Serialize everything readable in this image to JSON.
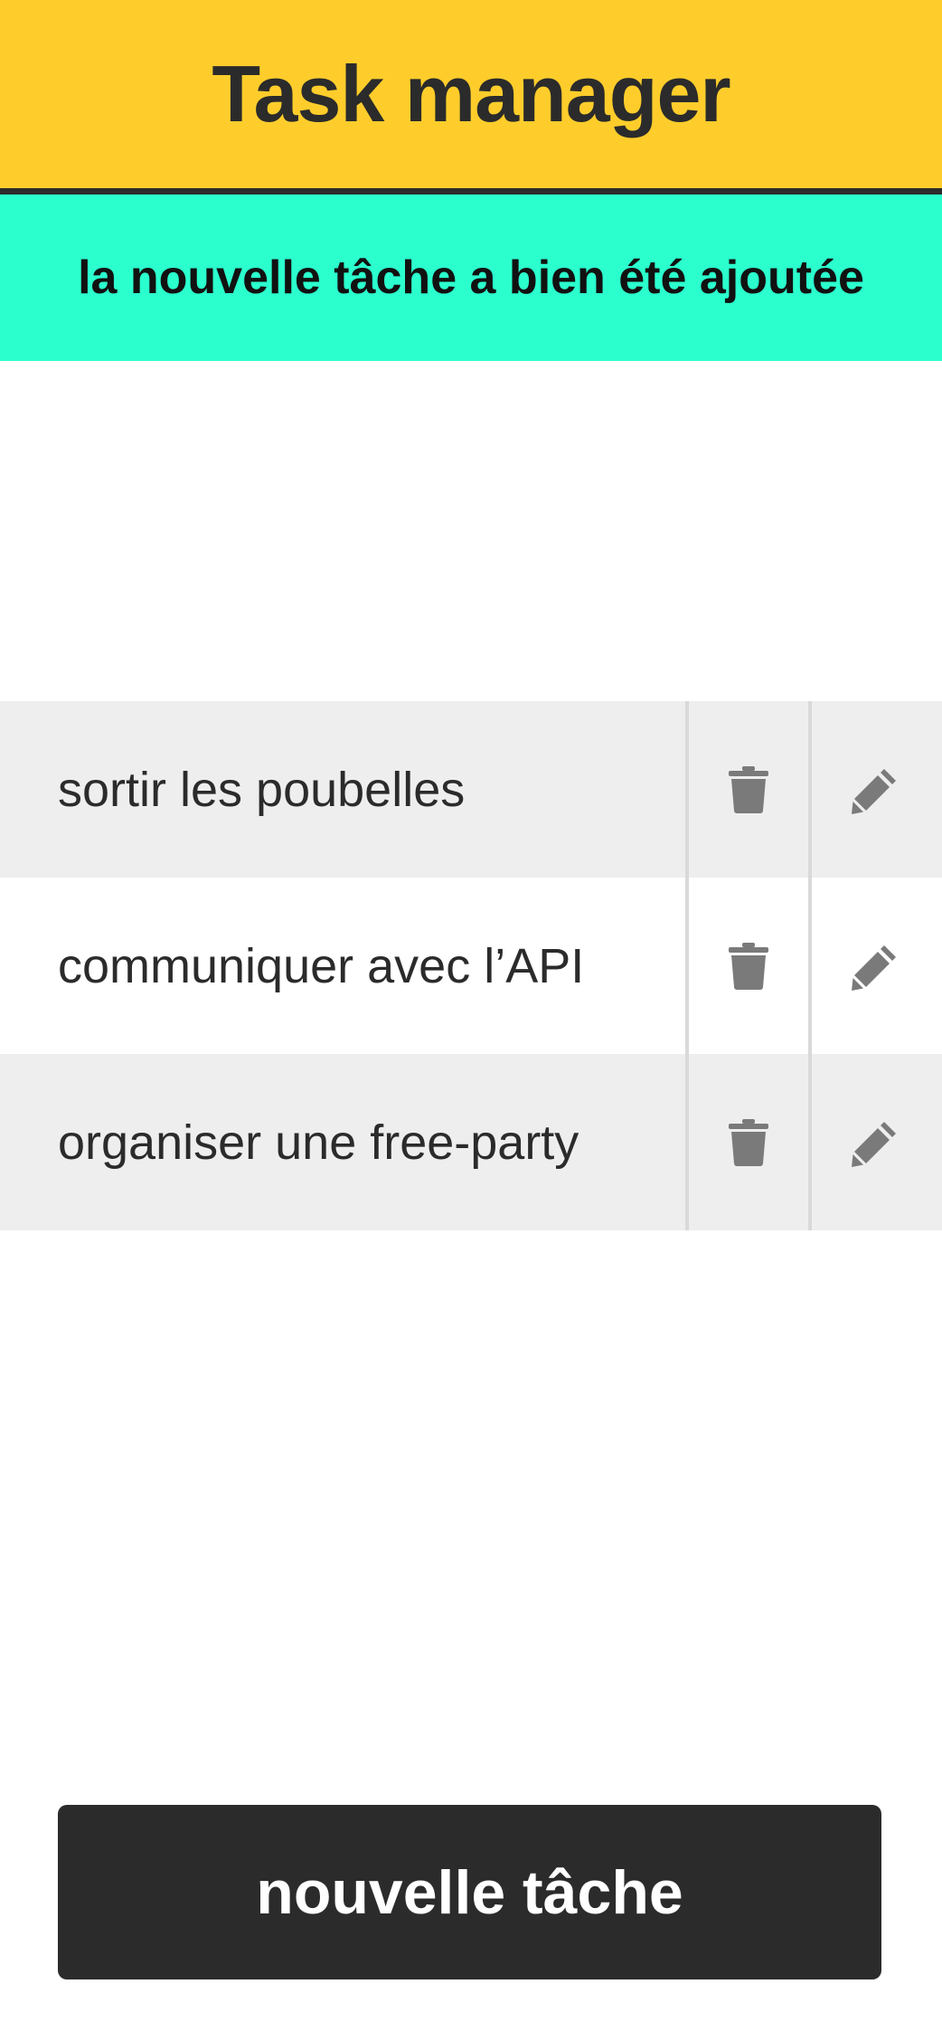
{
  "header": {
    "title": "Task manager"
  },
  "notice": {
    "message": "la nouvelle tâche a bien été ajoutée"
  },
  "tasks": [
    {
      "label": "sortir les poubelles",
      "delete_icon": "trash-icon",
      "edit_icon": "pencil-icon"
    },
    {
      "label": "communiquer avec l’API",
      "delete_icon": "trash-icon",
      "edit_icon": "pencil-icon"
    },
    {
      "label": "organiser une free-party",
      "delete_icon": "trash-icon",
      "edit_icon": "pencil-icon"
    }
  ],
  "footer": {
    "new_task_label": "nouvelle tâche"
  },
  "colors": {
    "header_background": "#ffcd2b",
    "notice_background": "#2bffcd",
    "row_shaded": "#eeeeee",
    "icon": "#7a7a7a",
    "button_background": "#2b2b2b",
    "button_text": "#ffffff"
  }
}
